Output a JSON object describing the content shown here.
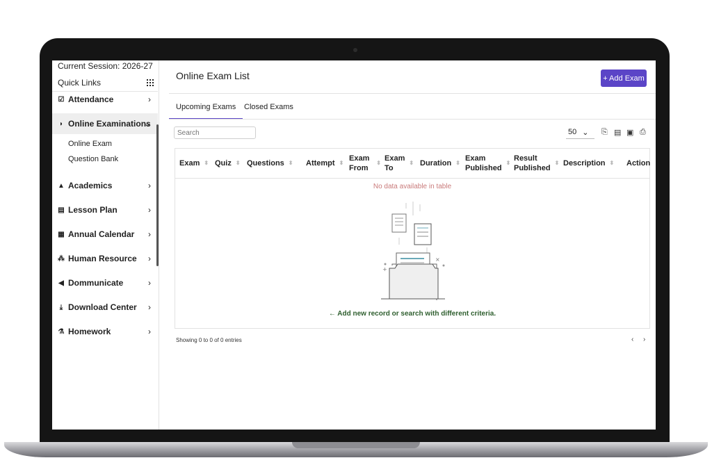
{
  "sidebar": {
    "session": "Current Session: 2026-27",
    "quick_links": "Quick Links",
    "items": [
      {
        "label": "Attendance",
        "icon": "calendar-check-icon"
      },
      {
        "label": "Online Examinations",
        "icon": "rss-icon"
      },
      {
        "label": "Academics",
        "icon": "graduation-cap-icon"
      },
      {
        "label": "Lesson Plan",
        "icon": "list-icon"
      },
      {
        "label": "Annual Calendar",
        "icon": "calendar-icon"
      },
      {
        "label": "Human Resource",
        "icon": "sitemap-icon"
      },
      {
        "label": "Dommunicate",
        "icon": "bullhorn-icon"
      },
      {
        "label": "Download Center",
        "icon": "download-icon"
      },
      {
        "label": "Homework",
        "icon": "flask-icon"
      }
    ],
    "sub_items": [
      "Online Exam",
      "Question Bank"
    ]
  },
  "main": {
    "title": "Online Exam List",
    "add_button": "+ Add Exam",
    "tabs": [
      "Upcoming Exams",
      "Closed Exams"
    ],
    "search_placeholder": "Search",
    "per_page": "50",
    "columns": [
      "Exam",
      "Quiz",
      "Questions",
      "Attempt",
      "Exam From",
      "Exam To",
      "Duration",
      "Exam Published",
      "Result Published",
      "Description",
      "Action"
    ],
    "no_data": "No data available in table",
    "add_record_hint": "← Add new record or search with different criteria.",
    "showing": "Showing 0 to 0 of 0 entries",
    "prev": "‹",
    "next": "›"
  },
  "colors": {
    "accent": "#5b45c7",
    "no_data": "#c97a7a",
    "hint": "#2e5e2e"
  }
}
